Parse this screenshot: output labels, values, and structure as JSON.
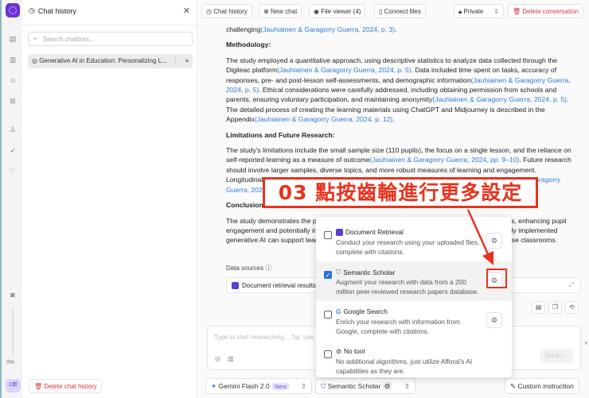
{
  "rail": {
    "progress": "0%",
    "avatar": "D窩"
  },
  "sidebar": {
    "title": "Chat history",
    "search_placeholder": "Search chatbots...",
    "items": [
      {
        "label": "Generative AI in Education: Personalizing L..."
      }
    ],
    "delete_label": "Delete chat history"
  },
  "toolbar": {
    "chat_history": "Chat history",
    "new_chat": "New chat",
    "file_viewer": "File viewer (4)",
    "connect_files": "Connect files",
    "privacy": "Private",
    "delete": "Delete conversation"
  },
  "content": {
    "p0": {
      "text": "challenging",
      "cite": "(Jauhiainen & Garagorry Guerra, 2024, p. 3)",
      "end": "."
    },
    "h1": "Methodology:",
    "p1": [
      {
        "t": "The study employed a quantitative approach, using descriptive statistics to analyze data collected through the Digileac platform"
      },
      {
        "c": "(Jauhiainen & Garagorry Guerra, 2024, p. 5)"
      },
      {
        "t": ". Data included time spent on tasks, accuracy of responses, pre- and post-lesson self-assessments, and demographic information"
      },
      {
        "c": "(Jauhiainen & Garagorry Guerra, 2024, p. 5)"
      },
      {
        "t": ". Ethical considerations were carefully addressed, including obtaining permission from schools and parents, ensuring voluntary participation, and maintaining anonymity"
      },
      {
        "c": "(Jauhiainen & Garagorry Guerra, 2024, p. 5)"
      },
      {
        "t": ". The detailed process of creating the learning materials using ChatGPT and Midjourney is described in the Appendix"
      },
      {
        "c": "(Jauhiainen & Garagorry Guerra, 2024, p. 12)"
      },
      {
        "t": "."
      }
    ],
    "h2": "Limitations and Future Research:",
    "p2": [
      {
        "t": "The study's limitations include the small sample size (110 pupils), the focus on a single lesson, and the reliance on self-reported learning as a measure of outcome"
      },
      {
        "c": "(Jauhiainen & Garagorry Guerra, 2024, pp. 9–10)"
      },
      {
        "t": ". Future research should involve larger samples, diverse topics, and more robust measures of learning and engagement. Longitudinal studies could explore long-term effects of personalized learning materials"
      },
      {
        "c": "(Jauhiainen & Garagorry Guerra, 2024, p. 10)"
      },
      {
        "t": "."
      }
    ],
    "h3": "Conclusion:",
    "p3": [
      {
        "t": "The study demonstrates the potential of ChatGPT to dynamically personalize learning materials, enhancing pupil engagement and potentially improving learning outcomes. The findings suggest that thoughtfully implemented generative AI can support teachers and be harnessed for tailored learning experiences in diverse classrooms."
      }
    ]
  },
  "data_sources": {
    "label": "Data sources",
    "item": "Document retrieval results"
  },
  "input": {
    "placeholder": "Type to start researching... Tip: use",
    "send": "Send"
  },
  "bottom": {
    "model": "Gemini Flash 2.0",
    "badge": "New",
    "tool": "Semantic Scholar",
    "custom": "Custom instruction"
  },
  "popup": {
    "options": [
      {
        "title": "Document Retrieval",
        "desc": "Conduct your research using your uploaded files, complete with citations.",
        "checked": false
      },
      {
        "title": "Semantic Scholar",
        "desc": "Augment your research with data from a 200 million peer-reviewed research papers database.",
        "checked": true
      },
      {
        "title": "Google Search",
        "desc": "Enrich your research with information from Google, complete with citations.",
        "checked": false
      },
      {
        "title": "No tool",
        "desc": "No additional algorithms, just utilize Afforai's AI capabilities as they are.",
        "checked": false
      }
    ]
  },
  "annotation": "03 點按齒輪進行更多設定",
  "colors": {
    "accent": "#6b32d6",
    "danger": "#d9363e",
    "link": "#2f7bd8",
    "annotation": "#e8331e"
  }
}
